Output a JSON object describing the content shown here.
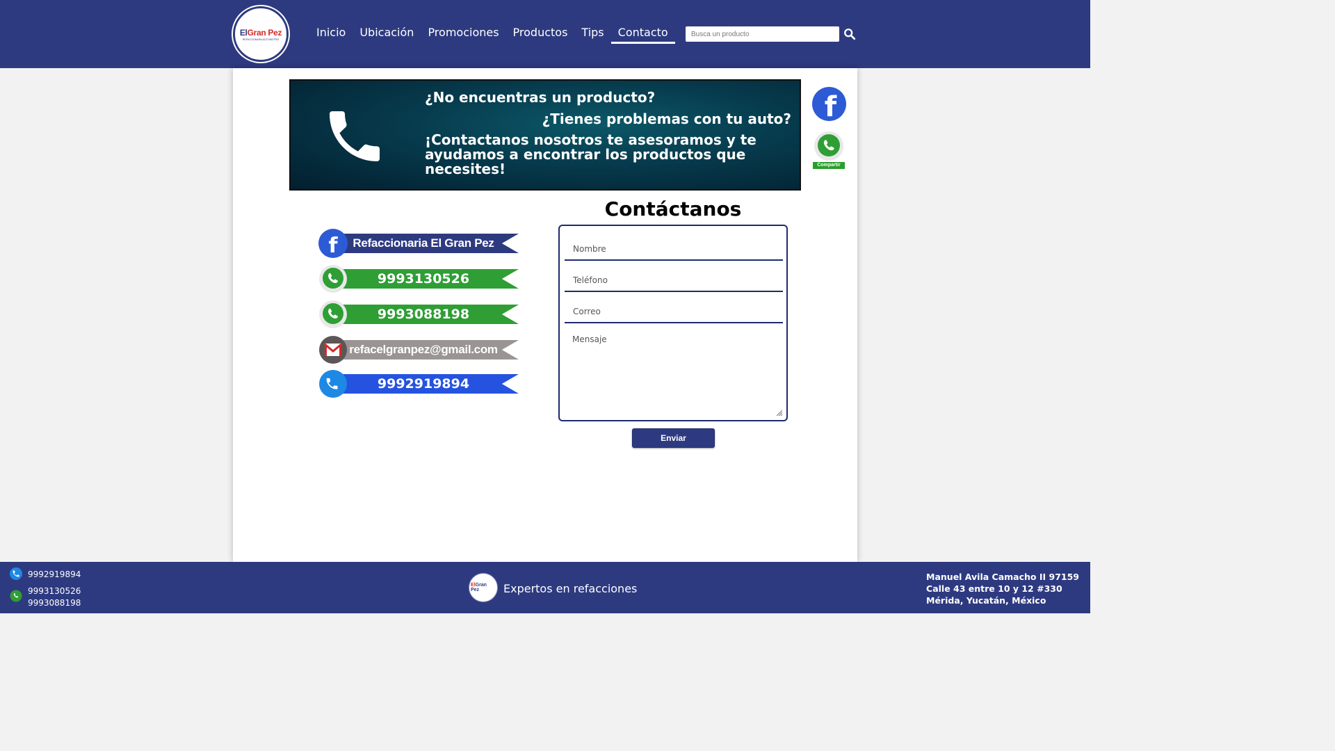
{
  "brand": {
    "logo_main": "Gran Pez",
    "logo_prefix": "El",
    "logo_sub": "REFACCIONARIA AUTOMOTRIZ"
  },
  "nav": {
    "items": [
      {
        "label": "Inicio"
      },
      {
        "label": "Ubicación"
      },
      {
        "label": "Promociones"
      },
      {
        "label": "Productos"
      },
      {
        "label": "Tips"
      },
      {
        "label": "Contacto",
        "active": true
      }
    ]
  },
  "search": {
    "placeholder": "Busca un producto",
    "value": "",
    "icon": "search-icon"
  },
  "banner": {
    "line1": "¿No encuentras un producto?",
    "line2": "¿Tienes problemas con tu auto?",
    "line3": "¡Contactanos nosotros te asesoramos y te ayudamos a encontrar los productos que necesites!",
    "icon": "phone-icon"
  },
  "social_float": {
    "facebook_icon": "facebook-icon",
    "whatsapp_icon": "whatsapp-icon",
    "whatsapp_label": "Compartir"
  },
  "contacts": [
    {
      "label": "Refaccionaria El Gran Pez",
      "icon": "facebook-icon",
      "color": "#2e3a80",
      "circle": "#2d5bd6"
    },
    {
      "label": "9993130526",
      "icon": "whatsapp-icon",
      "color": "#2f9e35",
      "circle": "#2f9e35"
    },
    {
      "label": "9993088198",
      "icon": "whatsapp-icon",
      "color": "#2f9e35",
      "circle": "#2f9e35"
    },
    {
      "label": "refacelgranpez@gmail.com",
      "icon": "gmail-icon",
      "color": "#9a9494",
      "circle": "#5c5656"
    },
    {
      "label": "9992919894",
      "icon": "phone-icon",
      "color": "#2553e0",
      "circle": "#1e88e5"
    }
  ],
  "form": {
    "title": "Contáctanos",
    "name_placeholder": "Nombre",
    "phone_placeholder": "Teléfono",
    "email_placeholder": "Correo",
    "message_placeholder": "Mensaje",
    "name_value": "",
    "phone_value": "",
    "email_value": "",
    "message_value": "",
    "submit_label": "Enviar"
  },
  "footer": {
    "phone": "9992919894",
    "whatsapp_1": "9993130526",
    "whatsapp_2": "9993088198",
    "slogan": "Expertos en refacciones",
    "address_1": "Manuel Avila Camacho II 97159",
    "address_2": "Calle 43 entre 10 y 12 #330",
    "address_3": "Mérida, Yucatán, México"
  },
  "colors": {
    "primary": "#2e3a80",
    "whatsapp": "#2f9e35",
    "accent_red": "#d42a2a"
  }
}
